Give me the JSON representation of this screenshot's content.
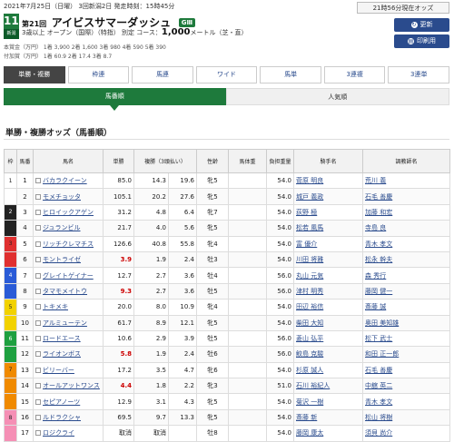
{
  "header": {
    "date_line": "2021年7月25日（日曜） 3回新潟2日 発走時刻：15時45分",
    "race_number": "11R",
    "race_badge": "新潟",
    "race_ordinal": "第21回",
    "race_name": "アイビスサマーダッシュ",
    "grade": "GⅢ",
    "conditions": "3歳以上 オープン（国際）（特指） 別定 コース：",
    "distance": "1,000",
    "course_suffix": "メートル（芝・直）",
    "prize_line1": "本賞金（万円） 1着 3,900 2着 1,600 3着 980 4着 590 5着 390",
    "prize_line2": "付加賞（万円） 1着 60.9 2着 17.4 3着 8.7"
  },
  "side": {
    "now_label": "21時56分現在オッズ",
    "refresh_label": "更新",
    "print_label": "印刷用"
  },
  "tabs": [
    "単勝・複勝",
    "枠連",
    "馬連",
    "ワイド",
    "馬単",
    "3連複",
    "3連単"
  ],
  "subtabs": [
    "馬番順",
    "人気順"
  ],
  "section_title": "単勝・複勝オッズ（馬番順）",
  "columns": [
    "枠",
    "馬番",
    "馬名",
    "単勝",
    "複勝（3頭払い）",
    "性齢",
    "馬体重",
    "負担重量",
    "騎手名",
    "調教師名"
  ],
  "colors": {
    "waku": [
      "#ffffff",
      "#222222",
      "#e03030",
      "#2a5bd7",
      "#f2d200",
      "#1ea040",
      "#f08a00",
      "#f58fb5"
    ]
  },
  "rows": [
    {
      "waku": "1",
      "umaban": "1",
      "name": "バカラクイーン",
      "odds": "85.0",
      "place_low": "14.3",
      "place_high": "19.6",
      "sex_age": "牝5",
      "weight": "",
      "kg": "54.0",
      "jockey": "菅原 明良",
      "trainer": "荒川 義"
    },
    {
      "waku": "",
      "umaban": "2",
      "name": "モメチョッタ",
      "odds": "105.1",
      "place_low": "20.2",
      "place_high": "27.6",
      "sex_age": "牝5",
      "weight": "",
      "kg": "54.0",
      "jockey": "城戸 義政",
      "trainer": "石毛 善慶"
    },
    {
      "waku": "2",
      "umaban": "3",
      "name": "ヒロイックアゲン",
      "odds": "31.2",
      "place_low": "4.8",
      "place_high": "6.4",
      "sex_age": "牝7",
      "weight": "",
      "kg": "54.0",
      "jockey": "荻野 極",
      "trainer": "加藤 和宏"
    },
    {
      "waku": "",
      "umaban": "4",
      "name": "ジュランビル",
      "odds": "21.7",
      "place_low": "4.0",
      "place_high": "5.6",
      "sex_age": "牝5",
      "weight": "",
      "kg": "54.0",
      "jockey": "松若 風馬",
      "trainer": "寺島 良"
    },
    {
      "waku": "3",
      "umaban": "5",
      "name": "リッチクレマチス",
      "odds": "126.6",
      "place_low": "40.8",
      "place_high": "55.8",
      "sex_age": "牝4",
      "weight": "",
      "kg": "54.0",
      "jockey": "富 優介",
      "trainer": "青木 孝文"
    },
    {
      "waku": "",
      "umaban": "6",
      "name": "モントライゼ",
      "odds": "3.9",
      "place_low": "1.9",
      "place_high": "2.4",
      "sex_age": "牡3",
      "weight": "",
      "kg": "54.0",
      "jockey": "川田 将雅",
      "trainer": "松永 幹夫"
    },
    {
      "waku": "4",
      "umaban": "7",
      "name": "グレイトゲイナー",
      "odds": "12.7",
      "place_low": "2.7",
      "place_high": "3.6",
      "sex_age": "牡4",
      "weight": "",
      "kg": "56.0",
      "jockey": "丸山 元気",
      "trainer": "森 秀行"
    },
    {
      "waku": "",
      "umaban": "8",
      "name": "タマモメイトウ",
      "odds": "9.3",
      "place_low": "2.7",
      "place_high": "3.6",
      "sex_age": "牡5",
      "weight": "",
      "kg": "56.0",
      "jockey": "津村 明秀",
      "trainer": "藤岡 健一"
    },
    {
      "waku": "5",
      "umaban": "9",
      "name": "トキメキ",
      "odds": "20.0",
      "place_low": "8.0",
      "place_high": "10.9",
      "sex_age": "牝4",
      "weight": "",
      "kg": "54.0",
      "jockey": "田辺 裕信",
      "trainer": "斎藤 誠"
    },
    {
      "waku": "",
      "umaban": "10",
      "name": "アルミューテン",
      "odds": "61.7",
      "place_low": "8.9",
      "place_high": "12.1",
      "sex_age": "牝5",
      "weight": "",
      "kg": "54.0",
      "jockey": "柴田 大知",
      "trainer": "奥田 美知雄"
    },
    {
      "waku": "6",
      "umaban": "11",
      "name": "ロードエース",
      "odds": "10.6",
      "place_low": "2.9",
      "place_high": "3.9",
      "sex_age": "牡5",
      "weight": "",
      "kg": "56.0",
      "jockey": "菱山 弘平",
      "trainer": "松下 武士"
    },
    {
      "waku": "",
      "umaban": "12",
      "name": "ライオンボス",
      "odds": "5.8",
      "place_low": "1.9",
      "place_high": "2.4",
      "sex_age": "牡6",
      "weight": "",
      "kg": "56.0",
      "jockey": "鮫島 克駿",
      "trainer": "和田 正一郎"
    },
    {
      "waku": "7",
      "umaban": "13",
      "name": "ビリーバー",
      "odds": "17.2",
      "place_low": "3.5",
      "place_high": "4.7",
      "sex_age": "牝6",
      "weight": "",
      "kg": "54.0",
      "jockey": "杉原 誠人",
      "trainer": "石毛 善慶"
    },
    {
      "waku": "",
      "umaban": "14",
      "name": "オールアットワンス",
      "odds": "4.4",
      "place_low": "1.8",
      "place_high": "2.2",
      "sex_age": "牝3",
      "weight": "",
      "kg": "51.0",
      "jockey": "石川 裕紀人",
      "trainer": "中舘 英二"
    },
    {
      "waku": "",
      "umaban": "15",
      "name": "セピアノーツ",
      "odds": "12.9",
      "place_low": "3.1",
      "place_high": "4.3",
      "sex_age": "牝5",
      "weight": "",
      "kg": "54.0",
      "jockey": "菊沢 一樹",
      "trainer": "青木 孝文"
    },
    {
      "waku": "8",
      "umaban": "16",
      "name": "ルドラクシャ",
      "odds": "69.5",
      "place_low": "9.7",
      "place_high": "13.3",
      "sex_age": "牝5",
      "weight": "",
      "kg": "54.0",
      "jockey": "斎藤 新",
      "trainer": "松山 将樹"
    },
    {
      "waku": "",
      "umaban": "17",
      "name": "ロジクライ",
      "odds": "取消",
      "place_low": "取消",
      "place_high": "",
      "sex_age": "牡8",
      "weight": "",
      "kg": "54.0",
      "jockey": "藤岡 康太",
      "trainer": "須貝 尚介"
    }
  ]
}
